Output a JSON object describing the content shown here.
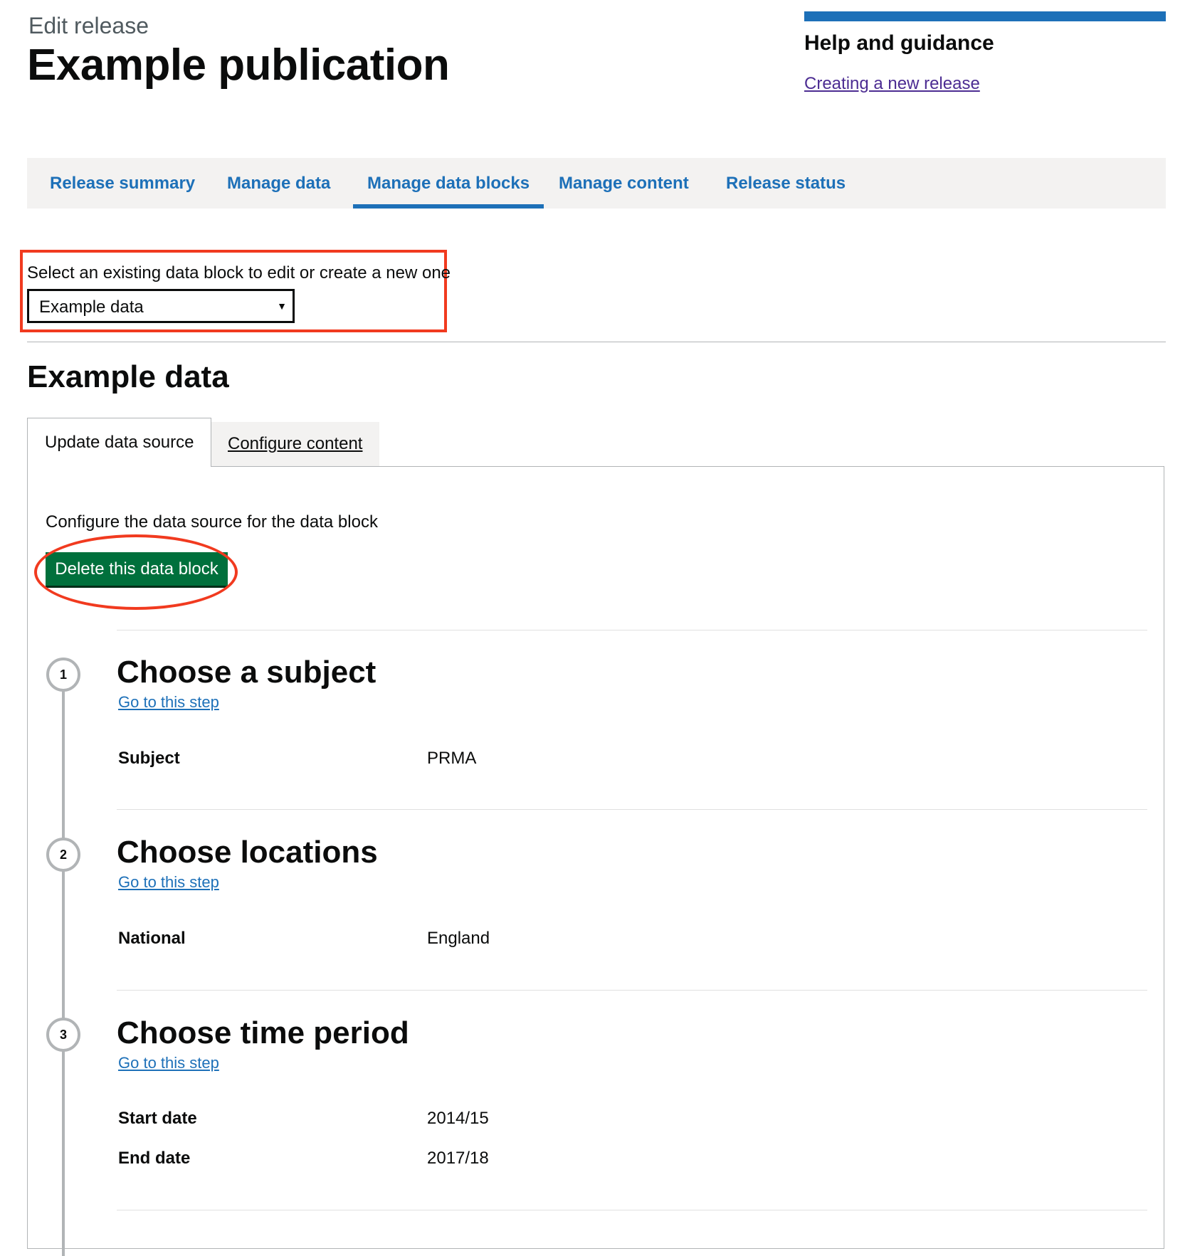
{
  "header": {
    "caption": "Edit release",
    "title": "Example publication"
  },
  "help": {
    "title": "Help and guidance",
    "link": "Creating a new release",
    "accent_color": "#1d70b8"
  },
  "nav": {
    "tabs": [
      {
        "label": "Release summary"
      },
      {
        "label": "Manage data"
      },
      {
        "label": "Manage data blocks",
        "active": true
      },
      {
        "label": "Manage content"
      },
      {
        "label": "Release status"
      }
    ]
  },
  "data_block_select": {
    "label": "Select an existing data block to edit or create a new one",
    "selected": "Example data"
  },
  "block": {
    "title": "Example data",
    "tabs": [
      {
        "label": "Update data source",
        "active": true
      },
      {
        "label": "Configure content"
      }
    ],
    "description": "Configure the data source for the data block",
    "delete_label": "Delete this data block",
    "delete_color": "#00703c",
    "highlight_color": "#f13a1f"
  },
  "steps": [
    {
      "number": "1",
      "title": "Choose a subject",
      "link": "Go to this step",
      "summary": [
        {
          "key": "Subject",
          "value": "PRMA"
        }
      ]
    },
    {
      "number": "2",
      "title": "Choose locations",
      "link": "Go to this step",
      "summary": [
        {
          "key": "National",
          "value": "England"
        }
      ]
    },
    {
      "number": "3",
      "title": "Choose time period",
      "link": "Go to this step",
      "summary": [
        {
          "key": "Start date",
          "value": "2014/15"
        },
        {
          "key": "End date",
          "value": "2017/18"
        }
      ]
    }
  ]
}
